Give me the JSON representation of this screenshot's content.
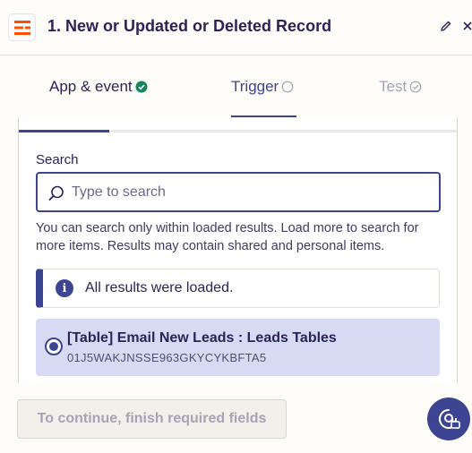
{
  "header": {
    "step_title": "1. New or Updated or Deleted Record",
    "logo_icon": "app-logo-icon",
    "edit_icon": "pencil-icon",
    "close_icon": "close-icon"
  },
  "tabs": [
    {
      "label": "App & event",
      "status": "complete",
      "icon": "check-circle-icon"
    },
    {
      "label": "Trigger",
      "status": "active",
      "icon": "empty-circle-icon"
    },
    {
      "label": "Test",
      "status": "disabled",
      "icon": "check-circle-outline-icon"
    }
  ],
  "search": {
    "label": "Search",
    "placeholder": "Type to search",
    "value": "",
    "help_text": "You can search only within loaded results. Load more to search for more items. Results may contain shared and personal items."
  },
  "alert": {
    "text": "All results were loaded.",
    "icon": "info-icon"
  },
  "results": [
    {
      "title": "[Table] Email New Leads : Leads Tables",
      "id": "01J5WAKJNSSE963GKYCYKBFTA5",
      "selected": true
    }
  ],
  "footer": {
    "continue_label": "To continue, finish required fields"
  },
  "colors": {
    "accent": "#3d4592",
    "brand_orange": "#ff4f00",
    "success": "#13855f",
    "selected_bg": "#d6daf3"
  }
}
